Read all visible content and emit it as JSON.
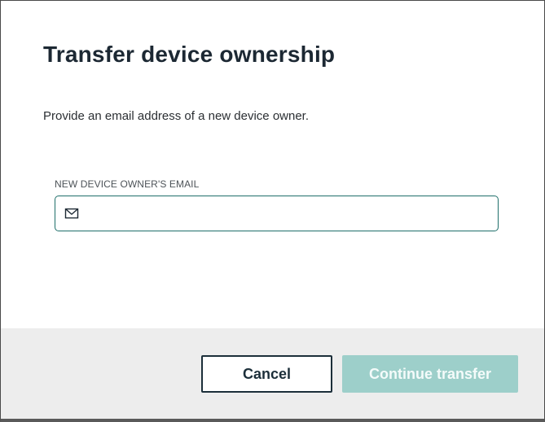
{
  "dialog": {
    "title": "Transfer device ownership",
    "description": "Provide an email address of a new device owner."
  },
  "email_field": {
    "label": "NEW DEVICE OWNER'S EMAIL",
    "value": "",
    "placeholder": "",
    "icon": "mail-icon"
  },
  "footer": {
    "cancel_label": "Cancel",
    "continue_label": "Continue transfer",
    "continue_enabled": false
  },
  "colors": {
    "accent_border": "#1f6f6a",
    "primary_disabled": "#9dcfca",
    "footer_bg": "#ededed",
    "title_text": "#1c2833"
  }
}
